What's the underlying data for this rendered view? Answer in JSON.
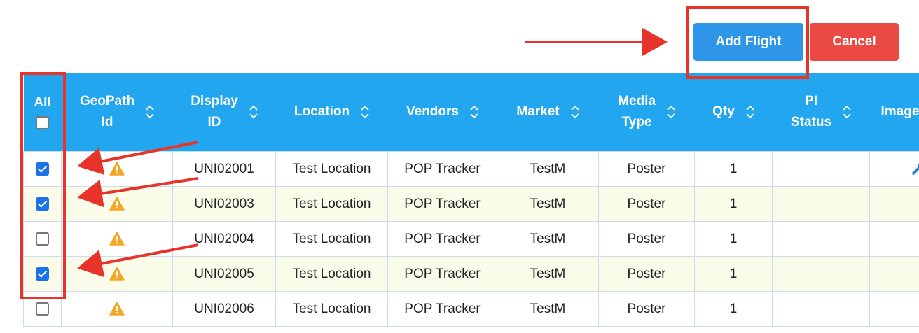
{
  "toolbar": {
    "add_flight_label": "Add Flight",
    "cancel_label": "Cancel"
  },
  "table": {
    "select_all_label": "All",
    "columns": [
      {
        "line1": "GeoPath",
        "line2": "Id"
      },
      {
        "line1": "Display",
        "line2": "ID"
      },
      {
        "line1": "Location",
        "line2": ""
      },
      {
        "line1": "Vendors",
        "line2": ""
      },
      {
        "line1": "Market",
        "line2": ""
      },
      {
        "line1": "Media",
        "line2": "Type"
      },
      {
        "line1": "Qty",
        "line2": ""
      },
      {
        "line1": "PI",
        "line2": "Status"
      },
      {
        "line1": "Image",
        "line2": ""
      }
    ],
    "rows": [
      {
        "checked": true,
        "geopath_icon": "warning-icon",
        "display_id": "UNI02001",
        "location": "Test Location",
        "vendor": "POP Tracker",
        "market": "TestM",
        "media_type": "Poster",
        "qty": "1",
        "pi_status": "",
        "image_icon": "wrench-icon"
      },
      {
        "checked": true,
        "geopath_icon": "warning-icon",
        "display_id": "UNI02003",
        "location": "Test Location",
        "vendor": "POP Tracker",
        "market": "TestM",
        "media_type": "Poster",
        "qty": "1",
        "pi_status": "",
        "image_icon": ""
      },
      {
        "checked": false,
        "geopath_icon": "warning-icon",
        "display_id": "UNI02004",
        "location": "Test Location",
        "vendor": "POP Tracker",
        "market": "TestM",
        "media_type": "Poster",
        "qty": "1",
        "pi_status": "",
        "image_icon": ""
      },
      {
        "checked": true,
        "geopath_icon": "warning-icon",
        "display_id": "UNI02005",
        "location": "Test Location",
        "vendor": "POP Tracker",
        "market": "TestM",
        "media_type": "Poster",
        "qty": "1",
        "pi_status": "",
        "image_icon": ""
      },
      {
        "checked": false,
        "geopath_icon": "warning-icon",
        "display_id": "UNI02006",
        "location": "Test Location",
        "vendor": "POP Tracker",
        "market": "TestM",
        "media_type": "Poster",
        "qty": "1",
        "pi_status": "",
        "image_icon": ""
      }
    ]
  },
  "colors": {
    "header_bg": "#22a6f0",
    "add_button": "#2e96e8",
    "cancel_button": "#ea4a43",
    "annotation": "#e8332a",
    "display_id_text": "#e0463c",
    "warning": "#f5a623",
    "row_alt_bg": "#fbfbea"
  }
}
